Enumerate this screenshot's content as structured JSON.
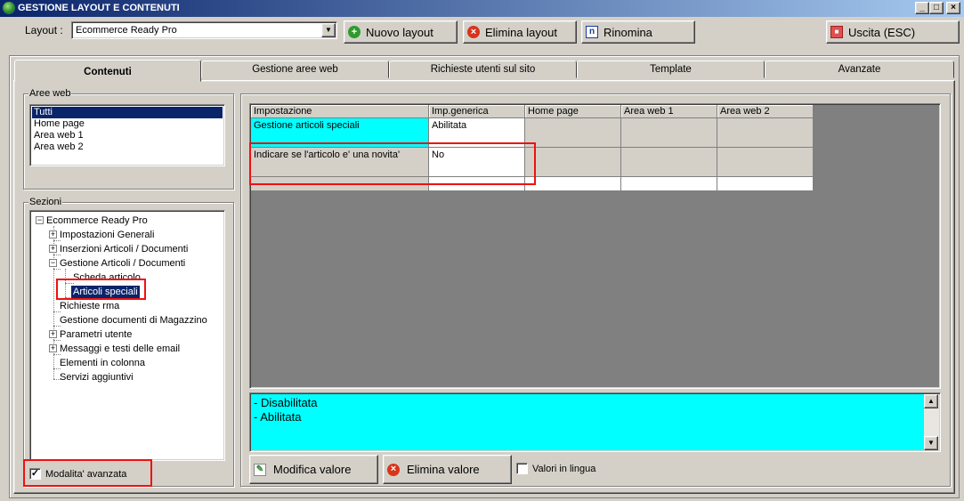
{
  "window": {
    "title": "GESTIONE LAYOUT E CONTENUTI",
    "controls": {
      "minimize": "_",
      "maximize": "□",
      "close": "×"
    }
  },
  "toolbar": {
    "layout_label": "Layout :",
    "layout_value": "Ecommerce Ready Pro",
    "new_layout": "Nuovo layout",
    "delete_layout": "Elimina layout",
    "rename": "Rinomina",
    "rename_icon_glyph": "n",
    "exit": "Uscita (ESC)"
  },
  "tabs": [
    {
      "label": "Contenuti",
      "active": true
    },
    {
      "label": "Gestione aree web",
      "active": false
    },
    {
      "label": "Richieste utenti sul sito",
      "active": false
    },
    {
      "label": "Template",
      "active": false
    },
    {
      "label": "Avanzate",
      "active": false
    }
  ],
  "web_areas": {
    "legend": "Aree web",
    "items": [
      "Tutti",
      "Home page",
      "Area web 1",
      "Area web 2"
    ],
    "selected": "Tutti"
  },
  "sections": {
    "legend": "Sezioni",
    "tree": {
      "root": "Ecommerce Ready Pro",
      "n1": "Impostazioni Generali",
      "n2": "Inserzioni Articoli / Documenti",
      "n3": "Gestione Articoli / Documenti",
      "n3a": "Scheda articolo",
      "n3b": "Articoli speciali",
      "n4": "Richieste rma",
      "n5": "Gestione documenti di Magazzino",
      "n6": "Parametri utente",
      "n7": "Messaggi e testi delle email",
      "n8": "Elementi in colonna",
      "n9": "Servizi aggiuntivi"
    },
    "selected": "Articoli speciali"
  },
  "advanced_mode": {
    "label": "Modalita' avanzata",
    "checked": true
  },
  "grid": {
    "columns": [
      "Impostazione",
      "Imp.generica",
      "Home page",
      "Area web 1",
      "Area web 2"
    ],
    "rows": [
      {
        "setting": "Gestione articoli speciali",
        "generic": "Abilitata",
        "home": "",
        "area1": "",
        "area2": ""
      },
      {
        "setting": "Indicare se l'articolo e' una novita'",
        "generic": "No",
        "home": "",
        "area1": "",
        "area2": ""
      }
    ]
  },
  "values_box": {
    "lines": [
      "- Disabilitata",
      "- Abilitata"
    ]
  },
  "bottom": {
    "edit_value": "Modifica valore",
    "delete_value": "Elimina valore",
    "lang_values": "Valori in lingua"
  },
  "colors": {
    "highlight_cyan": "#00ffff",
    "selection_blue": "#0a246a",
    "grid_background": "#808080",
    "annotation_red": "#e11111"
  }
}
